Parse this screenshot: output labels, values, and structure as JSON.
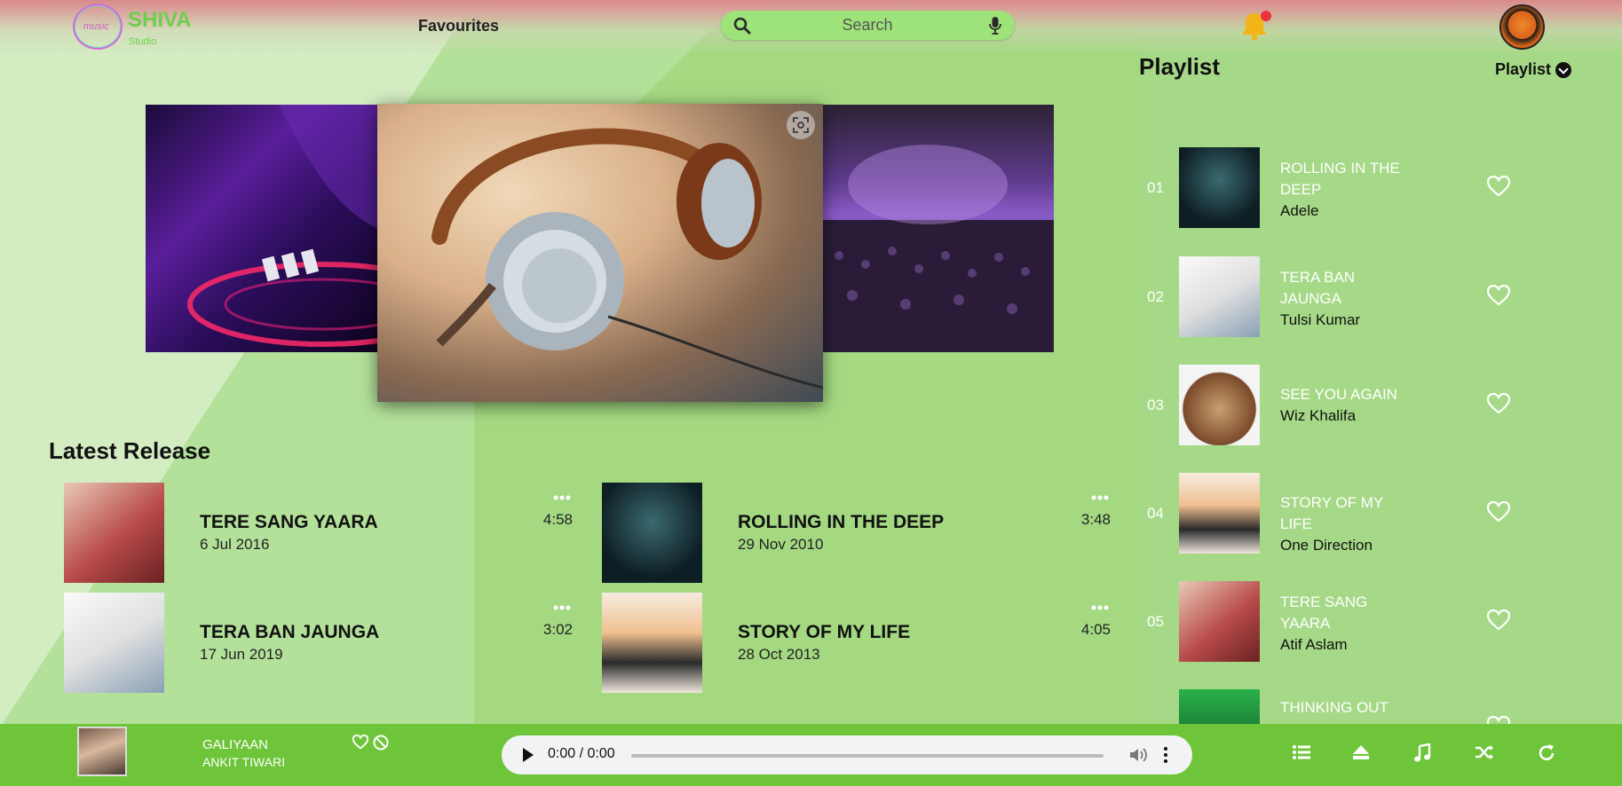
{
  "header": {
    "logo_text": "music",
    "brand": "SHIVA",
    "brand_sub": "Studio",
    "nav_favourites": "Favourites",
    "search_placeholder": "Search"
  },
  "playlist_panel": {
    "title": "Playlist",
    "dropdown_label": "Playlist",
    "items": [
      {
        "num": "01",
        "title": "ROLLING IN THE DEEP",
        "artist": "Adele",
        "art_colors": [
          "#0d2a30",
          "#1d5a60"
        ]
      },
      {
        "num": "02",
        "title": "TERA BAN JAUNGA",
        "artist": "Tulsi Kumar",
        "art_colors": [
          "#f4f4f4",
          "#d9d9d9"
        ]
      },
      {
        "num": "03",
        "title": "SEE YOU AGAIN",
        "artist": "Wiz Khalifa",
        "art_colors": [
          "#7a4a2a",
          "#c9a070"
        ]
      },
      {
        "num": "04",
        "title": "STORY OF MY LIFE",
        "artist": "One Direction",
        "art_colors": [
          "#f6ece0",
          "#e9823a"
        ]
      },
      {
        "num": "05",
        "title": "TERE SANG YAARA",
        "artist": "Atif Aslam",
        "art_colors": [
          "#b84a4a",
          "#e6c0b0"
        ]
      },
      {
        "num": "",
        "title": "THINKING OUT",
        "artist": "",
        "art_colors": [
          "#2ab04a",
          "#1a1a1a"
        ]
      }
    ]
  },
  "latest_release": {
    "title": "Latest Release",
    "cards": [
      {
        "name": "TERE SANG YAARA",
        "date": "6 Jul 2016",
        "duration": "4:58",
        "art_colors": [
          "#b84a4a",
          "#e6c0b0"
        ]
      },
      {
        "name": "ROLLING IN THE DEEP",
        "date": "29 Nov 2010",
        "duration": "3:48",
        "art_colors": [
          "#0d2a30",
          "#1d5a60"
        ]
      },
      {
        "name": "TERA BAN JAUNGA",
        "date": "17 Jun 2019",
        "duration": "3:02",
        "art_colors": [
          "#f4f4f4",
          "#d9d9d9"
        ]
      },
      {
        "name": "STORY OF MY LIFE",
        "date": "28 Oct 2013",
        "duration": "4:05",
        "art_colors": [
          "#f6ece0",
          "#e9823a"
        ]
      }
    ]
  },
  "player": {
    "title": "GALIYAAN",
    "artist": "ANKIT TIWARI",
    "time": "0:00 / 0:00",
    "controls": [
      "list-icon",
      "eject-icon",
      "music-note-icon",
      "shuffle-icon",
      "repeat-icon"
    ]
  },
  "colors": {
    "accent": "#6ec53a",
    "search_bg": "#9ee37a",
    "brand": "#6ccf4d",
    "notification": "#e8323c"
  }
}
